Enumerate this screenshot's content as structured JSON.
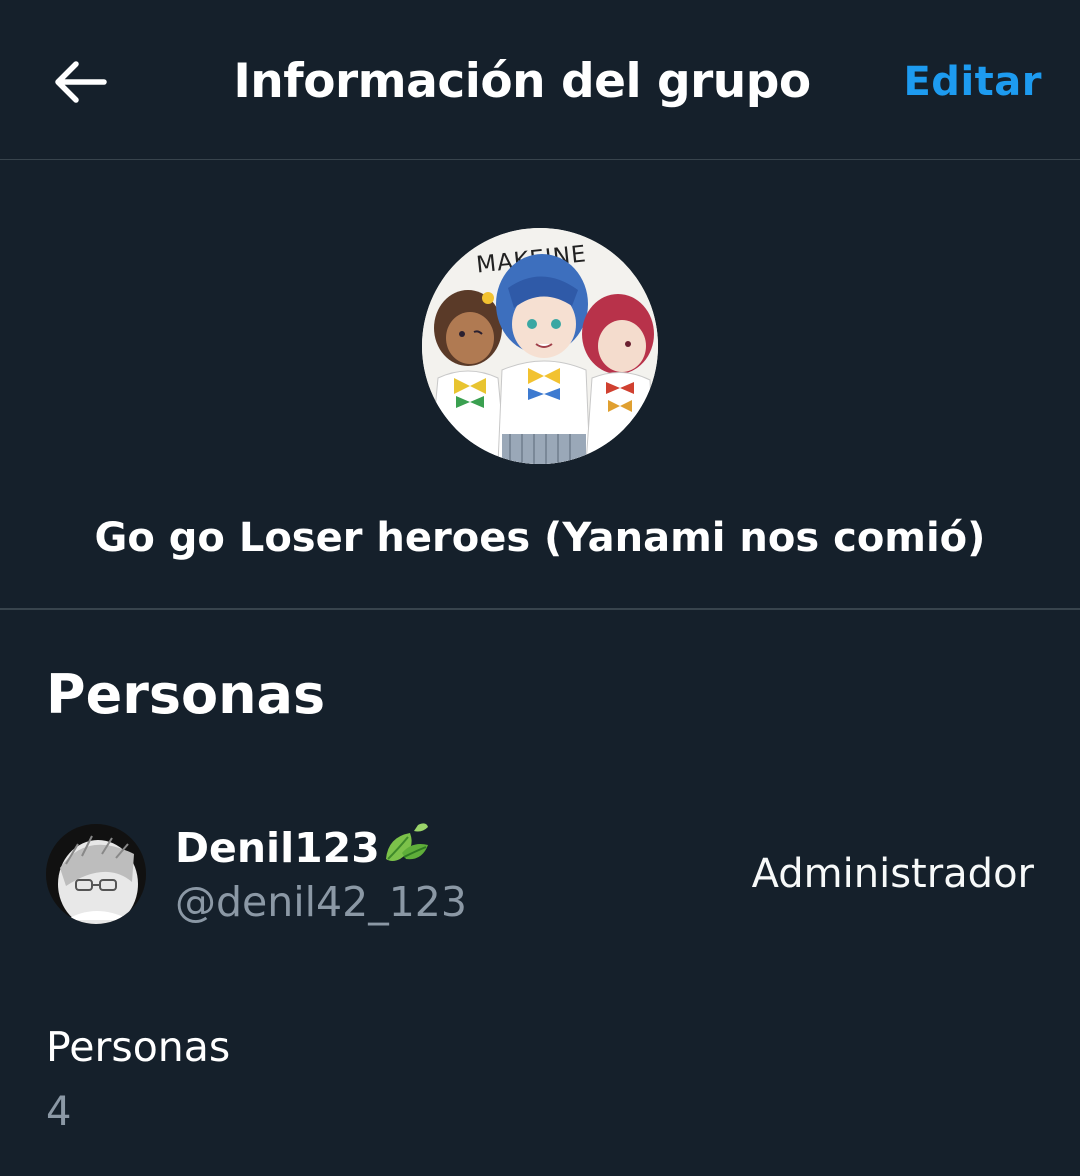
{
  "header": {
    "title": "Información del grupo",
    "edit_label": "Editar",
    "back_icon": "arrow-left-icon"
  },
  "group": {
    "name": "Go go Loser heroes (Yanami nos comió)",
    "avatar_text": "MAKEINE"
  },
  "people_section": {
    "heading": "Personas"
  },
  "members": [
    {
      "display_name": "Denil123",
      "name_emoji_icon": "leaf-icon",
      "handle": "@denil42_123",
      "role": "Administrador"
    }
  ],
  "count": {
    "label": "Personas",
    "value": "4"
  },
  "colors": {
    "background": "#15202b",
    "accent": "#1d9bf0",
    "divider": "#38444d",
    "secondary_text": "#8b98a5"
  }
}
